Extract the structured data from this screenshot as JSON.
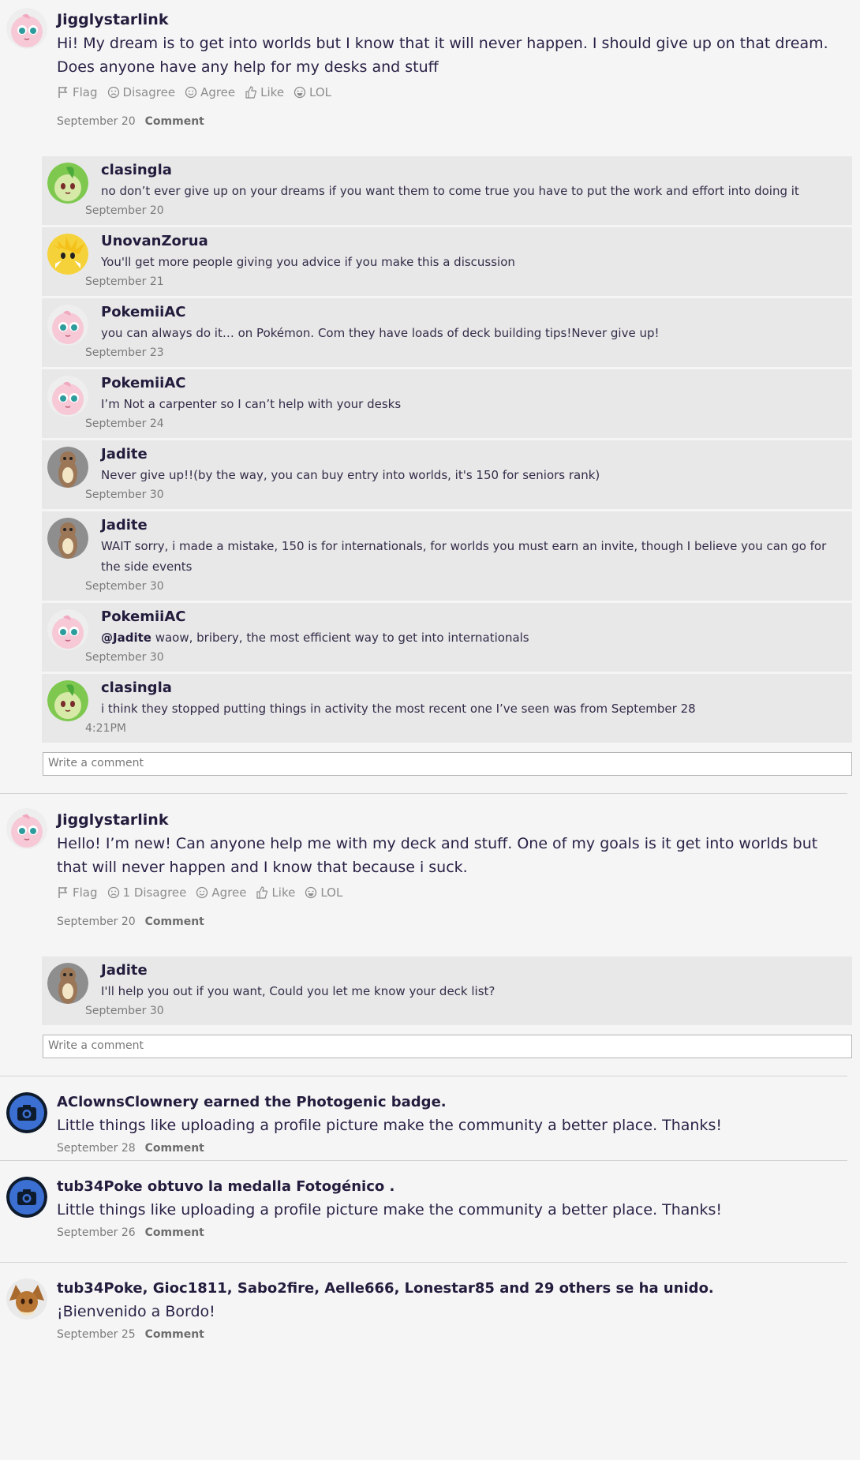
{
  "posts": [
    {
      "author": "Jigglystarlink",
      "text": "Hi! My dream is to get into worlds but I know that it will never happen. I should give up on that dream. Does anyone have any help for my desks and stuff",
      "reactions": {
        "flag": "Flag",
        "disagree": "Disagree",
        "agree": "Agree",
        "like": "Like",
        "lol": "LOL"
      },
      "date": "September 20",
      "comment_label": "Comment",
      "comments": [
        {
          "author": "clasingla",
          "text": "no don’t ever give up on your dreams if you want them to come true you have to put the work and effort into doing it",
          "date": "September 20"
        },
        {
          "author": "UnovanZorua",
          "text": "You'll get more people giving you advice if you make this a discussion",
          "date": "September 21"
        },
        {
          "author": "PokemiiAC",
          "text": "you can always do it… on Pokémon. Com they have loads of deck building tips!Never give up!",
          "date": "September 23"
        },
        {
          "author": "PokemiiAC",
          "text": "I’m Not a carpenter so I can’t help with your desks",
          "date": "September 24"
        },
        {
          "author": "Jadite",
          "text": "Never give up!!(by the way, you can buy entry into worlds, it's 150 for seniors rank)",
          "date": "September 30"
        },
        {
          "author": "Jadite",
          "text": "WAIT sorry, i made a mistake, 150 is for internationals, for worlds you must earn an invite, though I believe you can go for the side events",
          "date": "September 30"
        },
        {
          "author": "PokemiiAC",
          "mention": "@Jadite",
          "text": " waow, bribery, the most efficient way to get into internationals",
          "date": "September 30"
        },
        {
          "author": "clasingla",
          "text": "i think they stopped putting things in activity the most recent one I’ve seen was from September 28",
          "date": "4:21PM"
        }
      ],
      "write_placeholder": "Write a comment"
    },
    {
      "author": "Jigglystarlink",
      "text": "Hello! I’m new! Can anyone help me with my deck and stuff. One of my goals is it get into worlds but that will never happen and I know that because i suck.",
      "reactions": {
        "flag": "Flag",
        "disagree": "1 Disagree",
        "agree": "Agree",
        "like": "Like",
        "lol": "LOL"
      },
      "date": "September 20",
      "comment_label": "Comment",
      "comments": [
        {
          "author": "Jadite",
          "text": "I'll help you out if you want, Could you let me know your deck list?",
          "date": "September 30"
        }
      ],
      "write_placeholder": "Write a comment"
    }
  ],
  "badges": [
    {
      "title": "AClownsClownery earned the Photogenic badge.",
      "text": "Little things like uploading a profile picture make the community a better place. Thanks!",
      "date": "September 28",
      "comment_label": "Comment",
      "icon": "camera-icon"
    },
    {
      "title": "tub34Poke obtuvo la medalla Fotogénico .",
      "text": "Little things like uploading a profile picture make the community a better place. Thanks!",
      "date": "September 26",
      "comment_label": "Comment",
      "icon": "camera-icon"
    },
    {
      "title": "tub34Poke, Gioc1811, Sabo2fire, Aelle666, Lonestar85 and 29 others se ha unido.",
      "text": "¡Bienvenido a Bordo!",
      "date": "September 25",
      "comment_label": "Comment",
      "icon": "eevee-avatar"
    }
  ],
  "colors": {
    "accent": "#231c3d",
    "badge_blue": "#3b6fd1",
    "comment_bg": "#e8e8e8",
    "page_bg": "#f5f5f5"
  }
}
